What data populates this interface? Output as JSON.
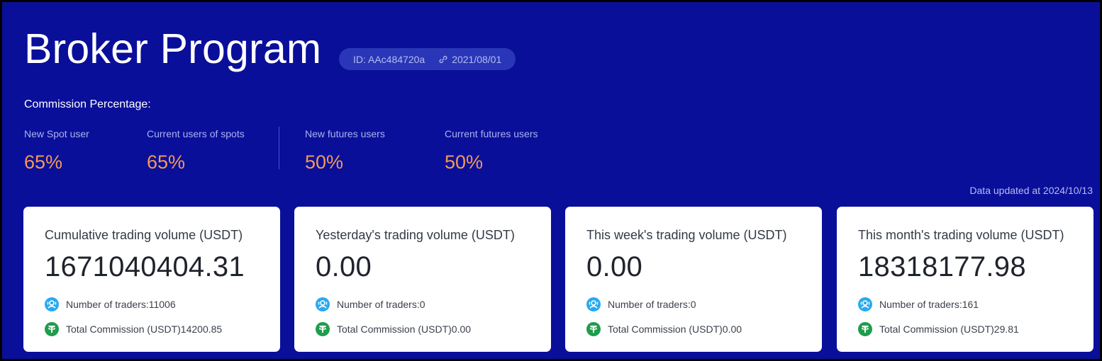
{
  "header": {
    "title": "Broker Program",
    "id_text": "ID: AAc484720a",
    "date": "2021/08/01",
    "link_icon": "link-icon"
  },
  "commission": {
    "label": "Commission Percentage:",
    "rates": [
      {
        "label": "New Spot user",
        "value": "65%"
      },
      {
        "label": "Current users of spots",
        "value": "65%"
      },
      {
        "label": "New futures users",
        "value": "50%"
      },
      {
        "label": "Current futures users",
        "value": "50%"
      }
    ]
  },
  "updated": "Data updated at 2024/10/13",
  "colors": {
    "background": "#0a0f9a",
    "accent_orange": "#f39a55",
    "traders_icon": "#29a9f0",
    "commission_icon": "#1f9d4c"
  },
  "cards": [
    {
      "title": "Cumulative trading volume (USDT)",
      "value": "1671040404.31",
      "traders": "Number of traders:11006",
      "commission": "Total Commission (USDT)14200.85"
    },
    {
      "title": "Yesterday's trading volume (USDT)",
      "value": "0.00",
      "traders": "Number of traders:0",
      "commission": "Total Commission (USDT)0.00"
    },
    {
      "title": "This week's trading volume (USDT)",
      "value": "0.00",
      "traders": "Number of traders:0",
      "commission": "Total Commission (USDT)0.00"
    },
    {
      "title": "This month's trading volume (USDT)",
      "value": "18318177.98",
      "traders": "Number of traders:161",
      "commission": "Total Commission (USDT)29.81"
    }
  ]
}
